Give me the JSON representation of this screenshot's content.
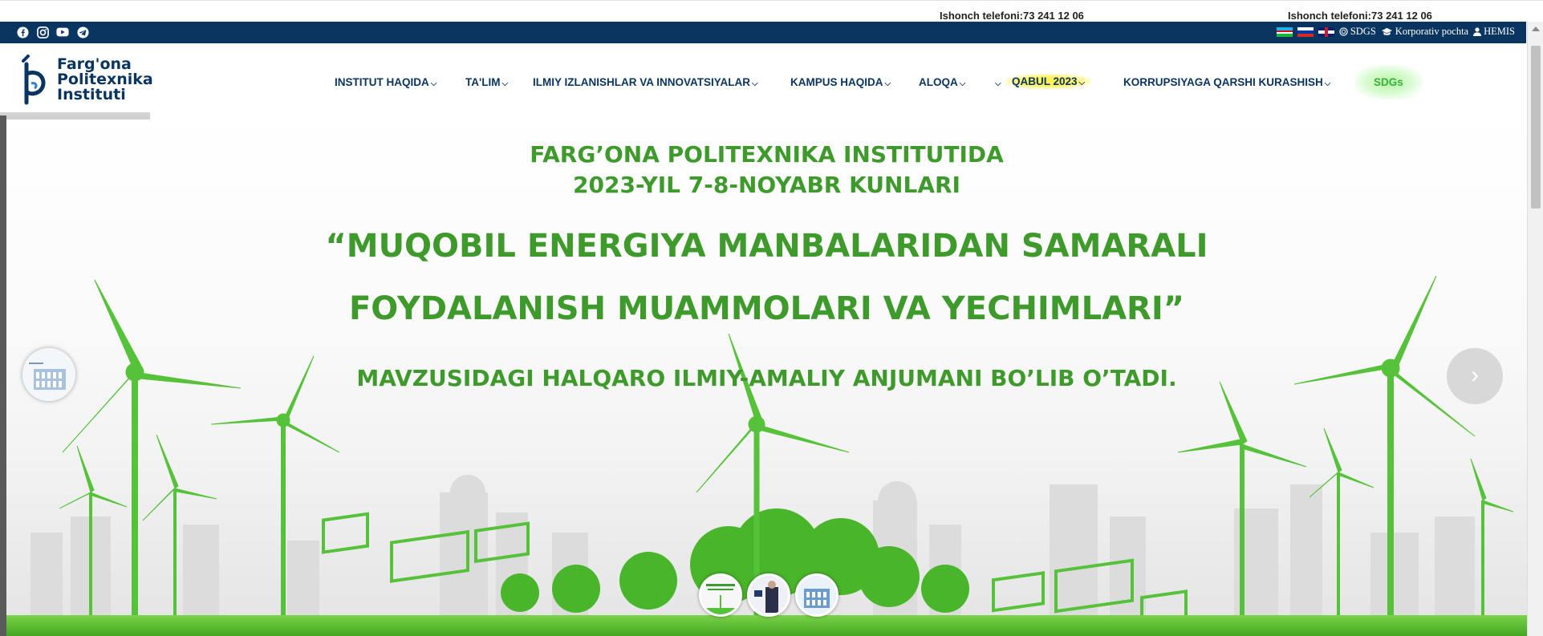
{
  "hotline": {
    "left_text": "Ishonch telefoni:73 241 12 06",
    "right_text": "Ishonch telefoni:73 241 12 06"
  },
  "topbar": {
    "social_icons": [
      "facebook-icon",
      "instagram-icon",
      "youtube-icon",
      "telegram-icon"
    ],
    "links": {
      "sdgs": "SDGS",
      "mail": "Korporativ pochta",
      "hemis": "HEMIS"
    },
    "colors": {
      "bar": "#0a3561"
    }
  },
  "logo": {
    "line1": "Farg'ona",
    "line2": "Politexnika",
    "line3": "Instituti"
  },
  "nav": {
    "items": [
      {
        "label": "INSTITUT HAQIDA"
      },
      {
        "label": "TA'LIM"
      },
      {
        "label": "ILMIY IZLANISHLAR VA INNOVATSIYALAR"
      },
      {
        "label": "KAMPUS HAQIDA"
      },
      {
        "label": "ALOQA"
      },
      {
        "label": "QABUL 2023"
      },
      {
        "label": "KORRUPSIYAGA QARSHI KURASHISH"
      },
      {
        "label": "SDGs"
      }
    ]
  },
  "hero": {
    "line1": "FARG’ONA POLITEXNIKA INSTITUTIDA",
    "line2": "2023-YIL 7-8-NOYABR KUNLARI",
    "line3": "“MUQOBIL ENERGIYA MANBALARIDAN SAMARALI",
    "line4": "FOYDALANISH MUAMMOLARI VA YECHIMLARI”",
    "line5": "MAVZUSIDAGI HALQARO ILMIY-AMALIY ANJUMANI BO’LIB O’TADI.",
    "next_arrow": "›",
    "colors": {
      "text": "#3d9a2b",
      "turbine": "#56c23a"
    }
  }
}
